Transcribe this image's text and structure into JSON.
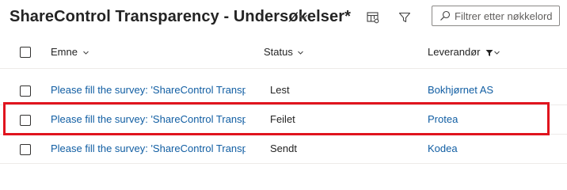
{
  "header": {
    "title": "ShareControl Transparency - Undersøkelser*",
    "search_placeholder": "Filtrer etter nøkkelord"
  },
  "columns": {
    "subject": "Emne",
    "status": "Status",
    "supplier": "Leverandør"
  },
  "rows": [
    {
      "subject": "Please fill the survey: 'ShareControl Transparency'",
      "status": "Lest",
      "supplier": "Bokhjørnet AS"
    },
    {
      "subject": "Please fill the survey: 'ShareControl Transparency'",
      "status": "Feilet",
      "supplier": "Protea"
    },
    {
      "subject": "Please fill the survey: 'ShareControl Transparency'",
      "status": "Sendt",
      "supplier": "Kodea"
    }
  ],
  "colors": {
    "link": "#115ea3",
    "highlight": "#e0141e",
    "text": "#242424"
  },
  "icons": [
    "chevron-down-icon",
    "grid-settings-icon",
    "filter-icon",
    "search-icon",
    "filter-funnel-filled-icon"
  ]
}
